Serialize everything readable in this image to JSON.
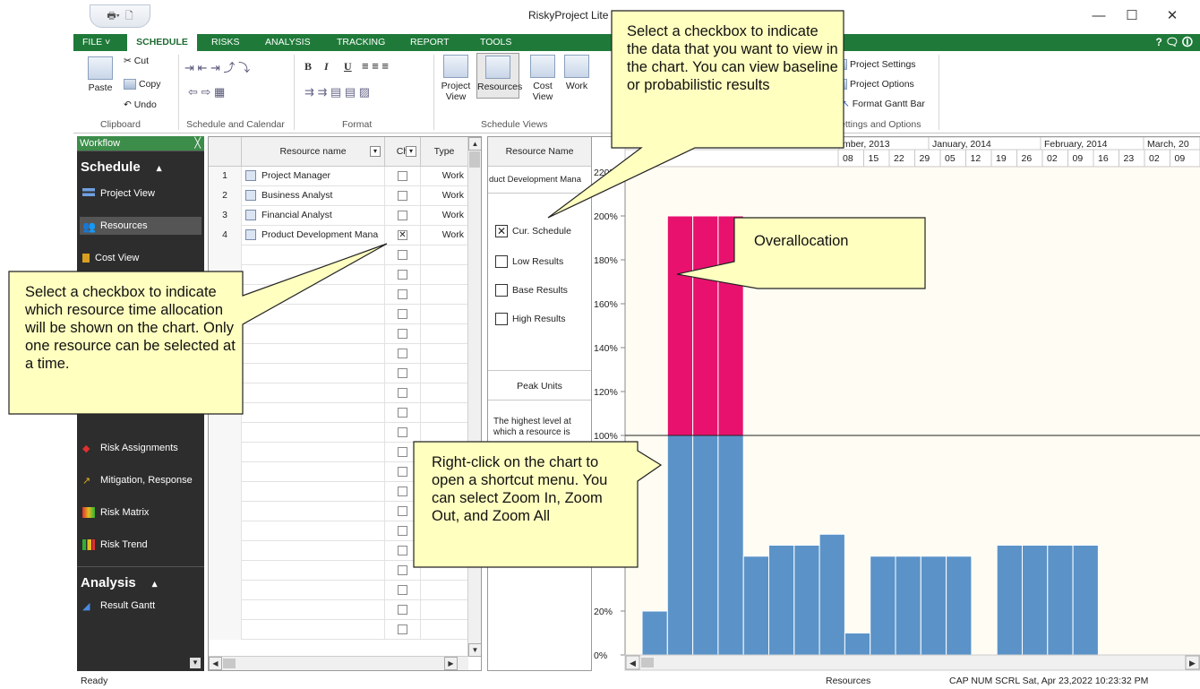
{
  "app": {
    "title": "RiskyProject Lite -"
  },
  "window_controls": {
    "minimize": "—",
    "maximize": "☐",
    "close": "✕"
  },
  "ribbon_tabs": [
    "FILE ˅",
    "SCHEDULE",
    "RISKS",
    "ANALYSIS",
    "TRACKING",
    "REPORT",
    "TOOLS"
  ],
  "tab_icons": "?  🗨  🛈",
  "clipboard": {
    "paste": "Paste",
    "cut": "Cut",
    "copy": "Copy",
    "undo": "Undo",
    "label": "Clipboard"
  },
  "schedule_calendar_label": "Schedule and Calendar",
  "format": {
    "bold": "B",
    "italic": "I",
    "underline": "U",
    "label": "Format"
  },
  "schedule_views": {
    "project_view": "Project\nView",
    "resources": "Resources",
    "cost_view": "Cost\nView",
    "work": "Work",
    "label": "Schedule Views"
  },
  "settings": {
    "project_settings": "Project Settings",
    "project_options": "Project Options",
    "format_gantt_bar": "Format Gantt Bar",
    "label": "ettings and Options"
  },
  "workflow": {
    "header": "Workflow",
    "close": "╳",
    "sections": [
      {
        "title": "Schedule",
        "arrow": "▴"
      },
      {
        "title": "Analysis",
        "arrow": "▴"
      }
    ],
    "items": [
      {
        "label": "Project View"
      },
      {
        "label": "Resources"
      },
      {
        "label": "Cost View"
      },
      {
        "label": "Risk Assignments"
      },
      {
        "label": "Mitigation, Response"
      },
      {
        "label": "Risk Matrix"
      },
      {
        "label": "Risk Trend"
      },
      {
        "label": "Result Gantt"
      }
    ]
  },
  "grid": {
    "headers": {
      "name": "Resource name",
      "chart": "Ch",
      "type": "Type"
    },
    "rows": [
      {
        "num": "1",
        "name": "Project Manager",
        "checked": false,
        "type": "Work"
      },
      {
        "num": "2",
        "name": "Business Analyst",
        "checked": false,
        "type": "Work"
      },
      {
        "num": "3",
        "name": "Financial Analyst",
        "checked": false,
        "type": "Work"
      },
      {
        "num": "4",
        "name": "Product Development Mana",
        "checked": true,
        "type": "Work"
      }
    ]
  },
  "legend": {
    "header": "Resource Name",
    "resource": "duct Development Mana",
    "checks": [
      {
        "label": "Cur. Schedule",
        "checked": true
      },
      {
        "label": "Low Results",
        "checked": false
      },
      {
        "label": "Base Results",
        "checked": false
      },
      {
        "label": "High Results",
        "checked": false
      }
    ],
    "peak_units": "Peak Units",
    "peak_desc": "The highest level at which a resource is"
  },
  "timeline": {
    "months": [
      "mber, 2013",
      "January, 2014",
      "February, 2014",
      "March, 20"
    ],
    "days": [
      "08",
      "15",
      "22",
      "29",
      "05",
      "12",
      "19",
      "26",
      "02",
      "09",
      "16",
      "23",
      "02",
      "09"
    ]
  },
  "chart_data": {
    "type": "bar",
    "y_ticks": [
      "220%",
      "200%",
      "180%",
      "160%",
      "140%",
      "120%",
      "100%",
      "20%",
      "0%"
    ],
    "ylim": [
      0,
      220
    ],
    "overallocation_line": 100,
    "weeks": [
      1,
      2,
      3,
      4,
      5,
      6,
      7,
      8,
      9,
      10,
      11,
      12,
      13,
      14,
      15,
      16,
      17,
      18
    ],
    "values": [
      20,
      200,
      200,
      200,
      45,
      50,
      50,
      55,
      10,
      45,
      45,
      45,
      45,
      0,
      50,
      50,
      50,
      50
    ],
    "colors": {
      "normal": "#5b93c8",
      "over": "#e8126e",
      "border": "#fff"
    }
  },
  "callouts": {
    "chart_checkbox": "Select a checkbox to indicate the data that you want to view in the chart. You can view baseline or probabilistic results",
    "resource_checkbox": "Select a checkbox to indicate which resource time allocation will be shown on the chart. Only one resource can be selected at a time.",
    "overallocation": "Overallocation",
    "right_click": "Right-click on the chart to open a shortcut menu. You can select Zoom In, Zoom Out, and Zoom All"
  },
  "status": {
    "left": "Ready",
    "view": "Resources",
    "right": "CAP  NUM  SCRL  Sat, Apr 23,2022  10:23:32 PM"
  }
}
